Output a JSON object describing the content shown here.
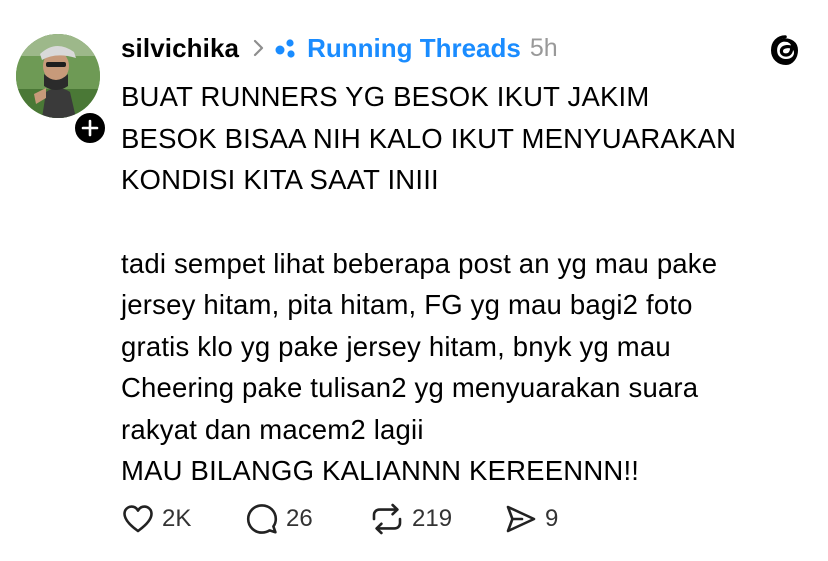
{
  "post": {
    "username": "silvichika",
    "community": "Running Threads",
    "time": "5h",
    "lines_caps": [
      "BUAT RUNNERS YG BESOK IKUT JAKIM",
      "BESOK BISAA NIH KALO IKUT MENYUARAKAN",
      "KONDISI KITA SAAT INIII"
    ],
    "lines_body": [
      "tadi sempet lihat beberapa post an yg mau pake",
      "jersey hitam, pita hitam, FG yg mau bagi2 foto",
      "gratis klo yg pake jersey hitam, bnyk yg mau",
      "Cheering pake tulisan2 yg menyuarakan suara",
      "rakyat dan macem2 lagii",
      "MAU BILANGG KALIANNN KEREENNN!!"
    ]
  },
  "actions": {
    "likes": "2K",
    "replies": "26",
    "reposts": "219",
    "shares": "9"
  },
  "icons": {
    "avatar": "profile-photo",
    "follow": "plus-icon",
    "chevron": "chevron-right-icon",
    "community": "community-dots-icon",
    "logo": "threads-logo-icon",
    "like": "heart-icon",
    "reply": "comment-icon",
    "repost": "repost-icon",
    "share": "send-icon"
  },
  "colors": {
    "community": "#1a8cff",
    "time": "#999999",
    "text": "#000000"
  }
}
